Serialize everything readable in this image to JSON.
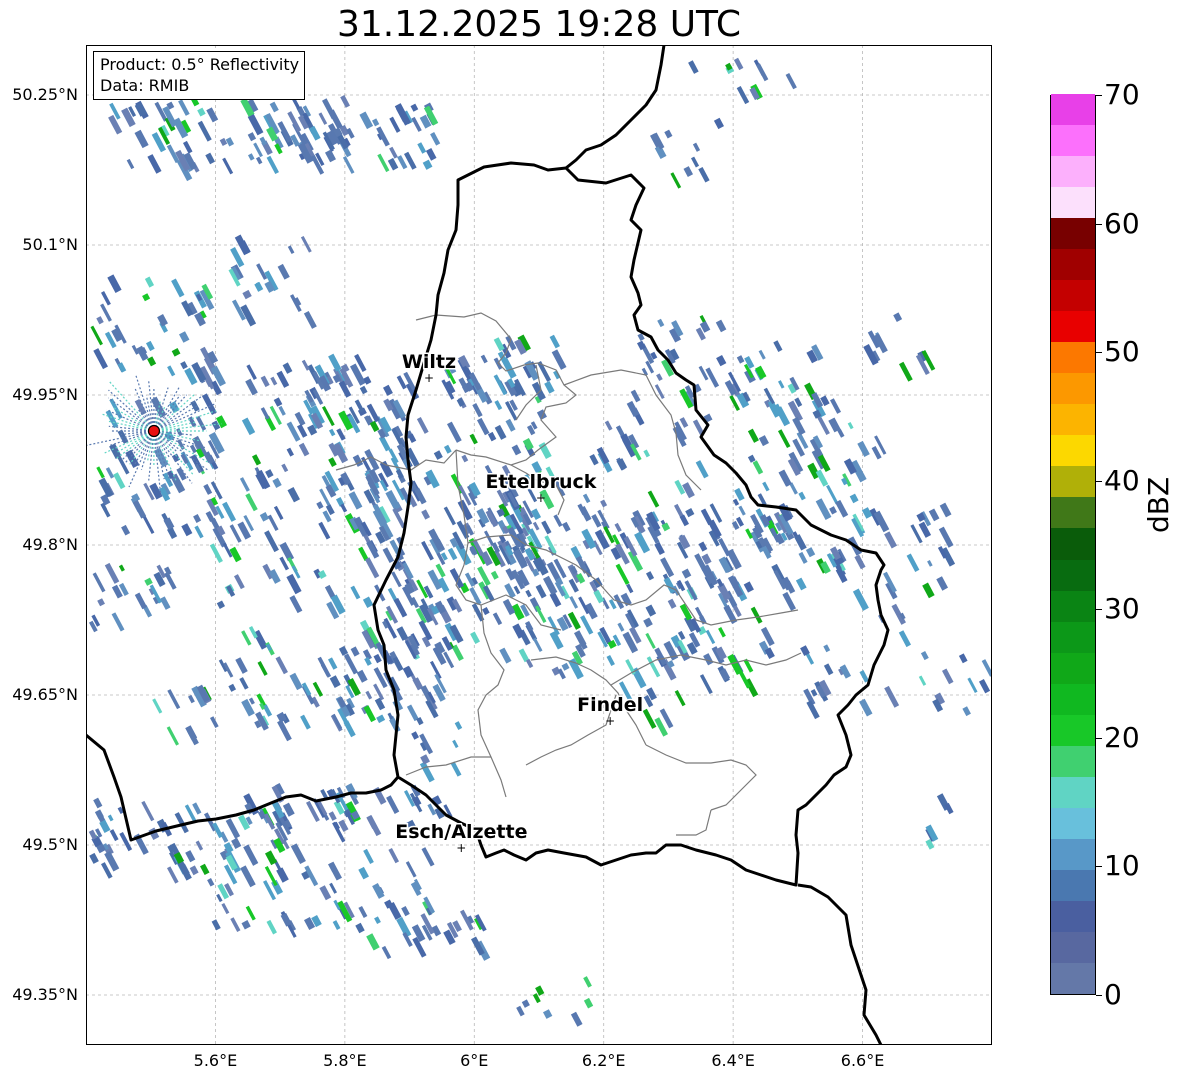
{
  "title": "31.12.2025 19:28 UTC",
  "info": {
    "product": "Product: 0.5° Reflectivity",
    "data": "Data: RMIB"
  },
  "map": {
    "lon_range": [
      5.4,
      6.8
    ],
    "lat_range": [
      49.3,
      50.3
    ],
    "lon_ticks": [
      {
        "value": 5.6,
        "label": "5.6°E"
      },
      {
        "value": 5.8,
        "label": "5.8°E"
      },
      {
        "value": 6.0,
        "label": "6°E"
      },
      {
        "value": 6.2,
        "label": "6.2°E"
      },
      {
        "value": 6.4,
        "label": "6.4°E"
      },
      {
        "value": 6.6,
        "label": "6.6°E"
      }
    ],
    "lat_ticks": [
      {
        "value": 50.25,
        "label": "50.25°N"
      },
      {
        "value": 50.1,
        "label": "50.1°N"
      },
      {
        "value": 49.95,
        "label": "49.95°N"
      },
      {
        "value": 49.8,
        "label": "49.8°N"
      },
      {
        "value": 49.65,
        "label": "49.65°N"
      },
      {
        "value": 49.5,
        "label": "49.5°N"
      },
      {
        "value": 49.35,
        "label": "49.35°N"
      }
    ],
    "cities": [
      {
        "name": "Wiltz",
        "lon": 5.93,
        "lat": 49.967
      },
      {
        "name": "Ettelbruck",
        "lon": 6.103,
        "lat": 49.847
      },
      {
        "name": "Findel",
        "lon": 6.21,
        "lat": 49.624
      },
      {
        "name": "Esch/Alzette",
        "lon": 5.98,
        "lat": 49.497
      }
    ],
    "radar_site": {
      "lon": 5.505,
      "lat": 49.914
    },
    "grid": true
  },
  "colorbar": {
    "label": "dBZ",
    "min": 0,
    "max": 70,
    "step": 2.5,
    "ticks": [
      "0",
      "10",
      "20",
      "30",
      "40",
      "50",
      "60",
      "70"
    ],
    "colors": [
      "#6478a8",
      "#5868a0",
      "#4a5fa0",
      "#4a78b0",
      "#5898c8",
      "#68c0dc",
      "#60d4c4",
      "#40d070",
      "#18c828",
      "#10b820",
      "#10a818",
      "#0c9818",
      "#0a8414",
      "#086c10",
      "#0a5c0a",
      "#407818",
      "#b0b008",
      "#fcd800",
      "#fcb400",
      "#fc9800",
      "#fc7800",
      "#e80000",
      "#c40000",
      "#a00000",
      "#780000",
      "#fce0fc",
      "#fcb0fc",
      "#fc70fc",
      "#e840e8"
    ]
  }
}
